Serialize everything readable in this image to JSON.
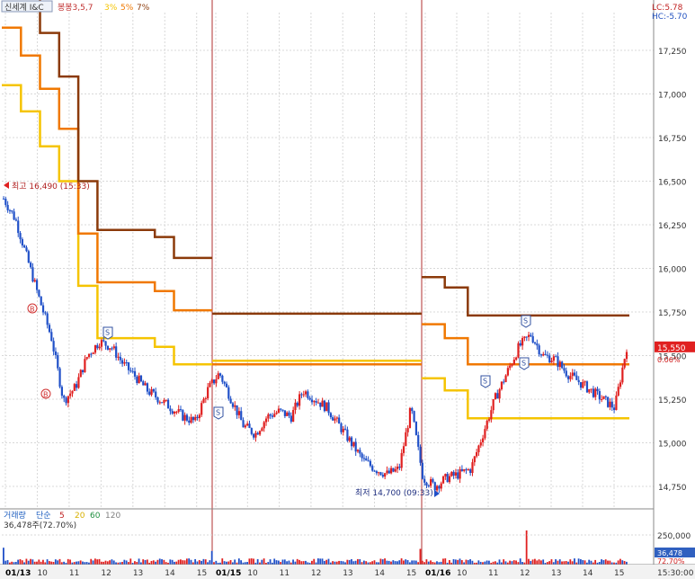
{
  "header": {
    "symbol_label": "신세계 I&C",
    "envelope_label": "봉봉3,5,7",
    "envelope_pcts": [
      "3%",
      "5%",
      "7%"
    ],
    "lc_label": "LC:5.78",
    "hc_label": "HC:-5.70"
  },
  "colors": {
    "env3": "#f5c400",
    "env5": "#f07800",
    "env7": "#8b3a0a",
    "up": "#e02020",
    "down": "#2050c8",
    "day_divider": "#b03030",
    "grid": "#d8d8d8",
    "price_box": "#e02020",
    "volume_box": "#3060c0"
  },
  "chart_data": {
    "type": "candlestick",
    "y_ticks": [
      "17,250",
      "17,000",
      "16,750",
      "16,500",
      "16,250",
      "16,000",
      "15,750",
      "15,500",
      "15,250",
      "15,000",
      "14,750"
    ],
    "ylim": [
      14700,
      17400
    ],
    "x_ticks": [
      "01/13",
      "10",
      "11",
      "12",
      "13",
      "14",
      "15",
      "01/15",
      "10",
      "11",
      "12",
      "13",
      "14",
      "15",
      "01/16",
      "10",
      "11",
      "12",
      "13",
      "14",
      "15"
    ],
    "time_label": "15:30:00",
    "days": [
      "01/13",
      "01/15",
      "01/16"
    ],
    "envelope_series": [
      {
        "name": "3%",
        "day_values": [
          [
            17050,
            16900,
            16700,
            16500,
            15900,
            15600,
            15600,
            15600,
            15550,
            15450,
            15450
          ],
          [
            15470,
            15470,
            15470,
            15470,
            15470,
            15470,
            15470,
            15470
          ],
          [
            15370,
            15300,
            15140,
            15140,
            15140,
            15140,
            15140,
            15140,
            15140
          ]
        ]
      },
      {
        "name": "5%",
        "day_values": [
          [
            17380,
            17220,
            17030,
            16800,
            16200,
            15920,
            15920,
            15920,
            15870,
            15760,
            15760
          ],
          [
            15450,
            15450,
            15450,
            15450,
            15450,
            15450,
            15450,
            15450
          ],
          [
            15680,
            15600,
            15450,
            15450,
            15450,
            15450,
            15450,
            15450,
            15450
          ]
        ]
      },
      {
        "name": "7%",
        "day_values": [
          [
            17700,
            17550,
            17350,
            17100,
            16500,
            16220,
            16220,
            16220,
            16180,
            16060,
            16060
          ],
          [
            15740,
            15740,
            15740,
            15740,
            15740,
            15740,
            15740,
            15740
          ],
          [
            15950,
            15890,
            15730,
            15730,
            15730,
            15730,
            15730,
            15730,
            15730
          ]
        ]
      }
    ],
    "price_path": [
      16400,
      16280,
      16050,
      15820,
      15600,
      15240,
      15320,
      15500,
      15580,
      15550,
      15450,
      15380,
      15300,
      15250,
      15200,
      15150,
      15120,
      15300,
      15400,
      15250,
      15100,
      15050,
      15150,
      15180,
      15150,
      15300,
      15250,
      15200,
      15100,
      15000,
      14900,
      14850,
      14820,
      14850,
      15200,
      14800,
      14750,
      14800,
      14820,
      14850,
      15050,
      15250,
      15400,
      15550,
      15620,
      15500,
      15480,
      15400,
      15350,
      15300,
      15250,
      15200,
      15550
    ],
    "volume": {
      "label": "거래량",
      "ma_label": "단순",
      "ma_periods": [
        "5",
        "20",
        "60",
        "120"
      ],
      "current_label": "36,478주(72.70%)",
      "axis_label": "250,000",
      "box_value": "36,478",
      "box_pct": "72.70%"
    },
    "annotations": {
      "high": "최고 16,490 (15:33)",
      "low": "최저 14,700 (09:33)",
      "last_price": "15,550",
      "last_change": "0.06%",
      "markers": [
        "B",
        "B",
        "S",
        "S",
        "S",
        "S",
        "S"
      ]
    }
  }
}
